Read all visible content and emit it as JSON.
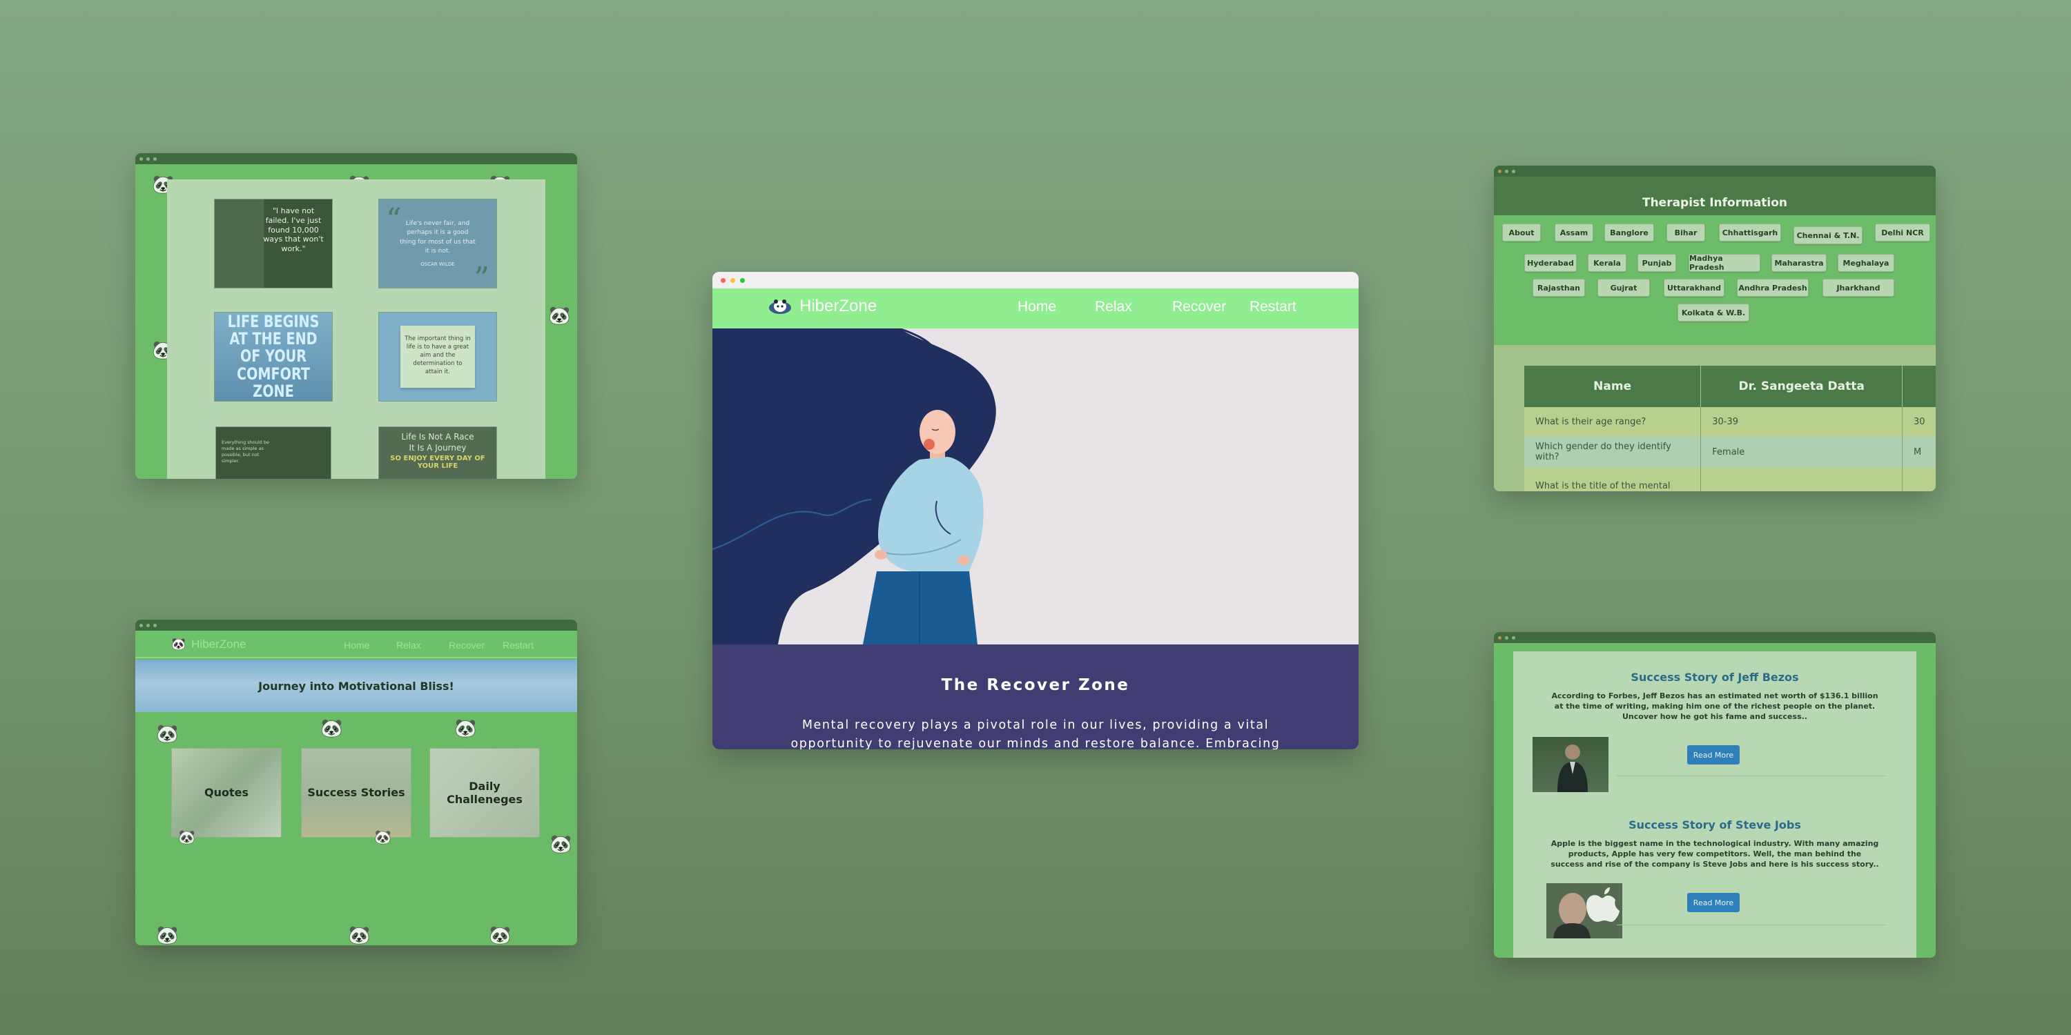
{
  "windows": {
    "quotes": {
      "cards": [
        {
          "text": "\"I have not failed. I've just found 10,000 ways that won't work.\""
        },
        {
          "text": "Life's never fair, and perhaps it is a good thing for most of us that it is not.",
          "author": "OSCAR WILDE"
        },
        {
          "text": "LIFE BEGINS AT THE END OF YOUR COMFORT ZONE"
        },
        {
          "text": "The important thing in life is to have a great aim and the determination to attain it."
        },
        {
          "text": "Everything should be made as simple as possible, but not simpler."
        },
        {
          "line1": "Life Is Not A Race",
          "line2": "It Is A Journey",
          "line3": "SO ENJOY EVERY DAY OF YOUR LIFE"
        }
      ]
    },
    "home": {
      "brand": "HiberZone",
      "nav": [
        "Home",
        "Relax",
        "Recover",
        "Restart"
      ],
      "banner": "Journey into Motivational Bliss!",
      "tiles": [
        "Quotes",
        "Success Stories",
        "Daily Challeneges"
      ]
    },
    "main": {
      "brand": "HiberZone",
      "nav": [
        "Home",
        "Relax",
        "Recover",
        "Restart"
      ],
      "heading": "The Recover Zone",
      "body": "Mental recovery plays a pivotal role in our lives, providing a vital opportunity to rejuvenate our minds and restore balance. Embracing"
    },
    "therapist": {
      "title": "Therapist Information",
      "chips": [
        "About",
        "Assam",
        "Banglore",
        "Bihar",
        "Chhattisgarh",
        "Chennai & T.N.",
        "Delhi NCR",
        "Hyderabad",
        "Kerala",
        "Punjab",
        "Madhya Pradesh",
        "Maharastra",
        "Meghalaya",
        "Rajasthan",
        "Gujrat",
        "Uttarakhand",
        "Andhra Pradesh",
        "Jharkhand",
        "Kolkata & W.B."
      ],
      "table": {
        "headers": [
          "Name",
          "Dr. Sangeeta Datta",
          ""
        ],
        "rows": [
          [
            "What is their age range?",
            "30-39",
            "30"
          ],
          [
            "Which gender do they identify with?",
            "Female",
            "M"
          ],
          [
            "What is the title of the mental",
            "",
            ""
          ]
        ]
      }
    },
    "success": {
      "stories": [
        {
          "title": "Success Story of Jeff Bezos",
          "text": "According to Forbes, Jeff Bezos has an estimated net worth of $136.1 billion at the time of writing, making him one of the richest people on the planet. Uncover how he got his fame and success..",
          "button": "Read More"
        },
        {
          "title": "Success Story of Steve Jobs",
          "text": "Apple is the biggest name in the technological industry. With many amazing products, Apple has very few competitors. Well, the man behind the success and rise of the company is Steve Jobs and here is his success story..",
          "button": "Read More"
        }
      ]
    }
  },
  "colors": {
    "accent_nav": "#90ee90",
    "recover_bg": "#3f3d72",
    "dark_green": "#4b7a48",
    "link_blue": "#2a6b8a",
    "button_blue": "#2f7fb9"
  },
  "icons": [
    "panda-icon",
    "hiberzone-logo-icon",
    "window-dot-icon"
  ]
}
